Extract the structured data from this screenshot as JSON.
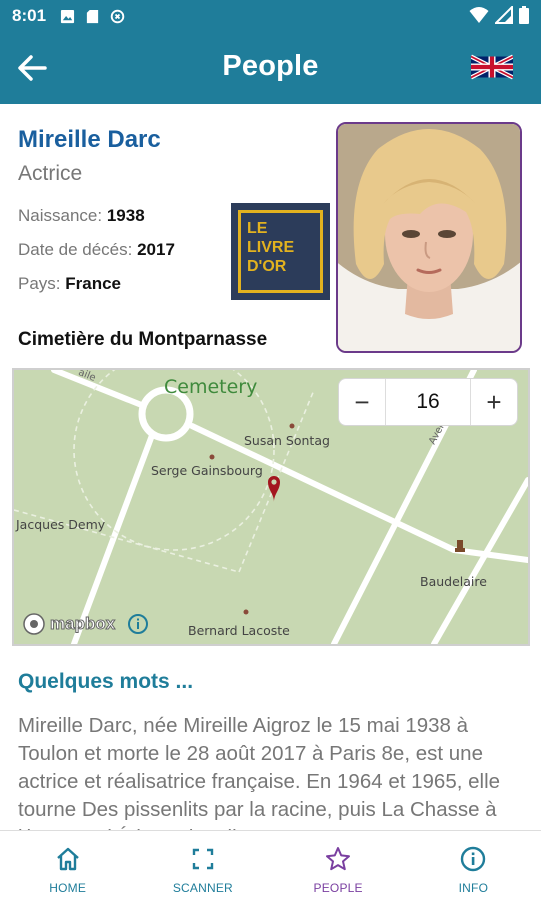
{
  "status_bar": {
    "time": "8:01"
  },
  "app_bar": {
    "title": "People"
  },
  "person": {
    "name": "Mireille Darc",
    "role": "Actrice",
    "birth_label": "Naissance:",
    "birth_value": "1938",
    "death_label": "Date de décés:",
    "death_value": "2017",
    "country_label": "Pays:",
    "country_value": "France"
  },
  "livre_dor": {
    "line1": "LE",
    "line2": "LIVRE",
    "line3": "D'OR"
  },
  "cemetery": {
    "title": "Cimetière du Montparnasse"
  },
  "map": {
    "area_label": "Cemetery",
    "zoom_value": "16",
    "zoom_minus": "−",
    "zoom_plus": "+",
    "places": [
      "Susan Sontag",
      "Serge Gainsbourg",
      "Jacques Demy",
      "Baudelaire",
      "Bernard Lacoste"
    ],
    "road_label_left": "aile",
    "road_label_right": "Avenue",
    "attribution": "mapbox"
  },
  "about": {
    "title": "Quelques mots ...",
    "text": "Mireille Darc, née Mireille Aigroz le 15 mai 1938 à Toulon et morte le 28 août 2017 à Paris 8e, est une actrice et réalisatrice française.  En 1964 et 1965, elle tourne Des pissenlits par la racine, puis La Chasse à l'homme d'Édouard Molinaro."
  },
  "bottom_nav": [
    {
      "label": "HOME"
    },
    {
      "label": "SCANNER"
    },
    {
      "label": "PEOPLE"
    },
    {
      "label": "INFO"
    }
  ],
  "colors": {
    "primary": "#1f7d9a",
    "name_blue": "#1a5f9e",
    "active_nav": "#7a3fa0",
    "map_green": "#c8d8b2",
    "marker": "#a3161f"
  }
}
